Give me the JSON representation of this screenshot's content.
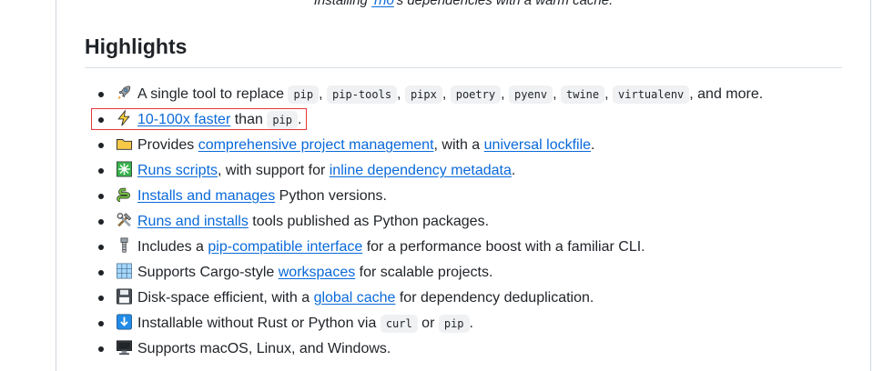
{
  "caption": {
    "prefix": "Installing ",
    "link": "Trio",
    "suffix": "'s dependencies with a warm cache."
  },
  "section": {
    "title": "Highlights"
  },
  "items": [
    {
      "icon": "rocket-icon",
      "parts": [
        {
          "t": "text",
          "v": "A single tool to replace "
        },
        {
          "t": "code",
          "v": "pip"
        },
        {
          "t": "text",
          "v": ", "
        },
        {
          "t": "code",
          "v": "pip-tools"
        },
        {
          "t": "text",
          "v": ", "
        },
        {
          "t": "code",
          "v": "pipx"
        },
        {
          "t": "text",
          "v": ", "
        },
        {
          "t": "code",
          "v": "poetry"
        },
        {
          "t": "text",
          "v": ", "
        },
        {
          "t": "code",
          "v": "pyenv"
        },
        {
          "t": "text",
          "v": ", "
        },
        {
          "t": "code",
          "v": "twine"
        },
        {
          "t": "text",
          "v": ", "
        },
        {
          "t": "code",
          "v": "virtualenv"
        },
        {
          "t": "text",
          "v": ", and more."
        }
      ]
    },
    {
      "icon": "lightning-icon",
      "parts": [
        {
          "t": "link",
          "v": "10-100x faster"
        },
        {
          "t": "text",
          "v": " than "
        },
        {
          "t": "code",
          "v": "pip"
        },
        {
          "t": "text",
          "v": "."
        }
      ]
    },
    {
      "icon": "folder-icon",
      "parts": [
        {
          "t": "text",
          "v": "Provides "
        },
        {
          "t": "link",
          "v": "comprehensive project management"
        },
        {
          "t": "text",
          "v": ", with a "
        },
        {
          "t": "link",
          "v": "universal lockfile"
        },
        {
          "t": "text",
          "v": "."
        }
      ]
    },
    {
      "icon": "sparkle-icon",
      "parts": [
        {
          "t": "link",
          "v": "Runs scripts"
        },
        {
          "t": "text",
          "v": ", with support for "
        },
        {
          "t": "link",
          "v": "inline dependency metadata"
        },
        {
          "t": "text",
          "v": "."
        }
      ]
    },
    {
      "icon": "snake-icon",
      "parts": [
        {
          "t": "link",
          "v": "Installs and manages"
        },
        {
          "t": "text",
          "v": " Python versions."
        }
      ]
    },
    {
      "icon": "tools-icon",
      "parts": [
        {
          "t": "link",
          "v": "Runs and installs"
        },
        {
          "t": "text",
          "v": " tools published as Python packages."
        }
      ]
    },
    {
      "icon": "bolts-icon",
      "parts": [
        {
          "t": "text",
          "v": "Includes a "
        },
        {
          "t": "link",
          "v": "pip-compatible interface"
        },
        {
          "t": "text",
          "v": " for a performance boost with a familiar CLI."
        }
      ]
    },
    {
      "icon": "grid-icon",
      "parts": [
        {
          "t": "text",
          "v": "Supports Cargo-style "
        },
        {
          "t": "link",
          "v": "workspaces"
        },
        {
          "t": "text",
          "v": " for scalable projects."
        }
      ]
    },
    {
      "icon": "floppy-disk-icon",
      "parts": [
        {
          "t": "text",
          "v": "Disk-space efficient, with a "
        },
        {
          "t": "link",
          "v": "global cache"
        },
        {
          "t": "text",
          "v": " for dependency deduplication."
        }
      ]
    },
    {
      "icon": "down-arrow-icon",
      "parts": [
        {
          "t": "text",
          "v": "Installable without Rust or Python via "
        },
        {
          "t": "code",
          "v": "curl"
        },
        {
          "t": "text",
          "v": " or "
        },
        {
          "t": "code",
          "v": "pip"
        },
        {
          "t": "text",
          "v": "."
        }
      ]
    },
    {
      "icon": "desktop-computer-icon",
      "parts": [
        {
          "t": "text",
          "v": "Supports macOS, Linux, and Windows."
        }
      ]
    }
  ],
  "colors": {
    "link": "#0969da",
    "highlight_box": "#e5373b",
    "code_bg": "#eff1f3"
  }
}
